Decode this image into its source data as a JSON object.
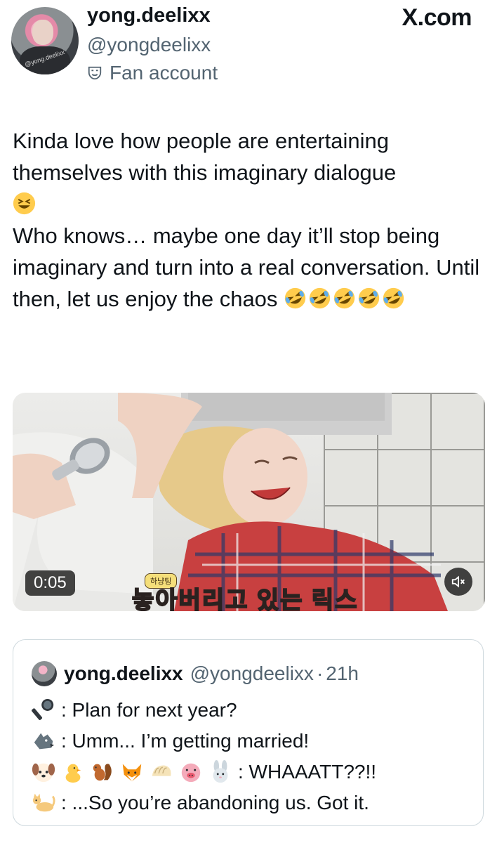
{
  "author": {
    "display_name": "yong.deelixx",
    "handle": "@yongdeelixx",
    "label": "Fan account",
    "avatar_watermark": "@yong.deelixx"
  },
  "brand": "X.com",
  "tweet": {
    "text": "Kinda love how people are entertaining themselves with this imaginary dialogue\n",
    "text2": "Who knows… maybe one day it’ll stop being imaginary and turn into a real conversation. Until then, let us enjoy the chaos ",
    "emojis_line1": [
      "grinning-squinting-face"
    ],
    "emojis_end": [
      "rolling-on-floor-laughing",
      "rolling-on-floor-laughing",
      "rolling-on-floor-laughing",
      "rolling-on-floor-laughing",
      "rolling-on-floor-laughing"
    ]
  },
  "video": {
    "duration": "0:05",
    "caption_badge": "하냥팅",
    "caption": "놓아버리고 있는 릭스",
    "mute_icon": "speaker-muted-icon"
  },
  "quoted": {
    "display_name": "yong.deelixx",
    "handle": "@yongdeelixx",
    "separator": "·",
    "time": "21h",
    "lines": [
      {
        "icons": [
          "microphone"
        ],
        "text": ": Plan for next year?"
      },
      {
        "icons": [
          "wolf"
        ],
        "text": ": Umm... I’m getting married!"
      },
      {
        "icons": [
          "dog",
          "chick",
          "squirrel",
          "fox",
          "dumpling",
          "pig",
          "rabbit"
        ],
        "text": ": WHAAATT??!!"
      },
      {
        "icons": [
          "cat"
        ],
        "text": ": ...So you’re abandoning us. Got it."
      }
    ]
  },
  "colors": {
    "text": "#0f1419",
    "secondary": "#536471",
    "border": "#cfd9de"
  }
}
